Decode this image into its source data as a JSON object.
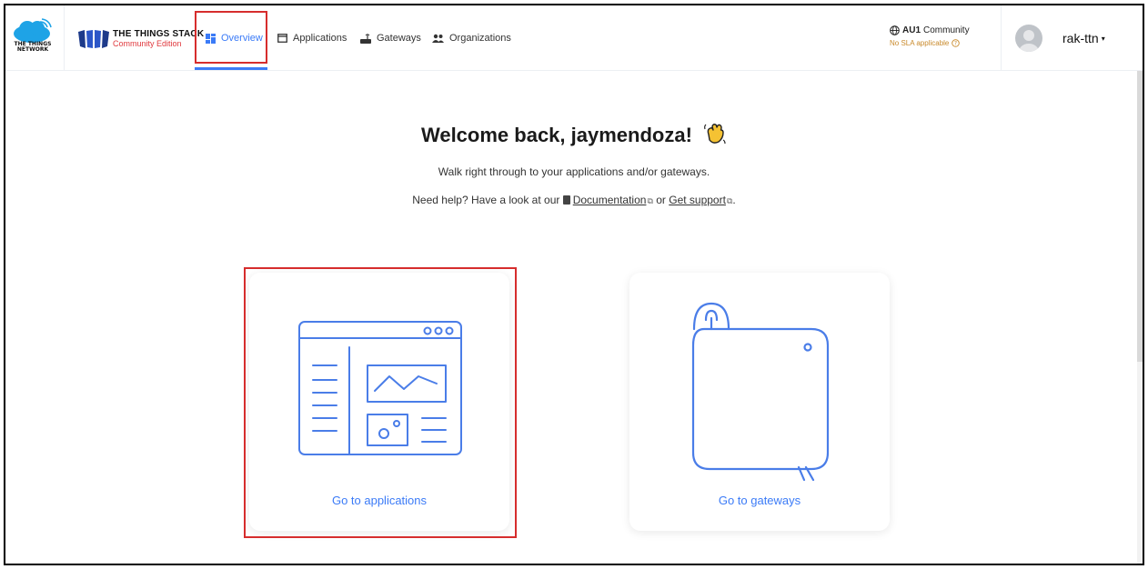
{
  "brand": {
    "ttn_text_line1": "THE THINGS",
    "ttn_text_line2": "NETWORK",
    "tts_title": "THE THINGS STACK",
    "tts_subtitle": "Community Edition"
  },
  "nav": {
    "items": [
      {
        "label": "Overview",
        "icon": "dashboard-icon",
        "active": true
      },
      {
        "label": "Applications",
        "icon": "window-icon"
      },
      {
        "label": "Gateways",
        "icon": "gateway-icon"
      },
      {
        "label": "Organizations",
        "icon": "people-icon"
      }
    ]
  },
  "cluster": {
    "name": "AU1",
    "label": "Community",
    "sla": "No SLA applicable",
    "icon": "globe-icon"
  },
  "user": {
    "name": "rak-ttn",
    "icon": "avatar-icon"
  },
  "main": {
    "welcome": "Welcome back, jaymendoza!",
    "subtitle": "Walk right through to your applications and/or gateways.",
    "help_prefix": "Need help? Have a look at our",
    "documentation": "Documentation",
    "or": "or",
    "support": "Get support",
    "help_suffix": "."
  },
  "cards": {
    "applications": "Go to applications",
    "gateways": "Go to gateways"
  },
  "colors": {
    "accent": "#3b7bf7",
    "highlight": "#d62d2d",
    "brand_red": "#e0393e",
    "sla": "#c98a2b"
  }
}
